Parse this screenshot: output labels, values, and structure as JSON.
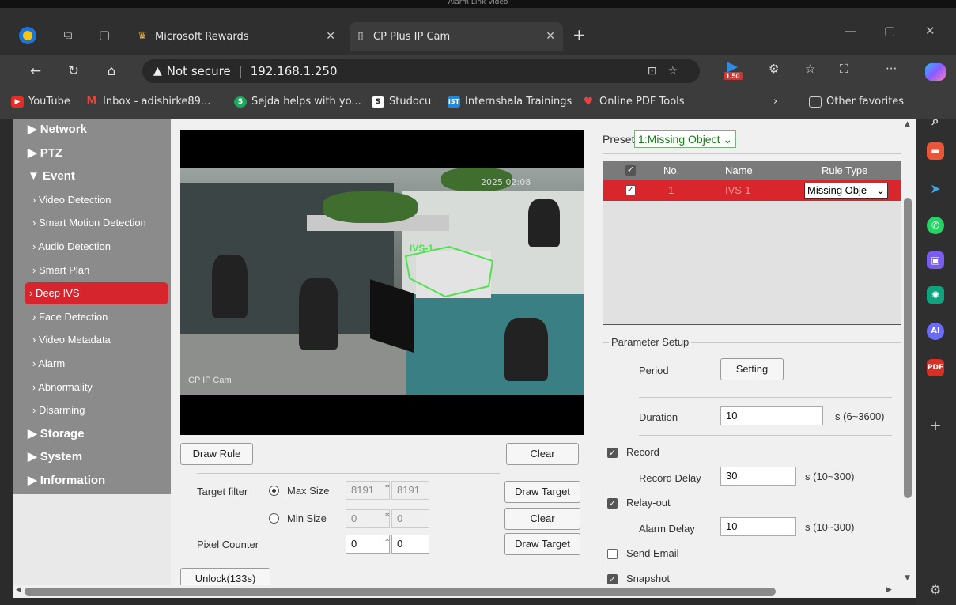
{
  "top_title": "Alarm Link Video",
  "browser": {
    "tabs": [
      {
        "label": "Microsoft Rewards"
      },
      {
        "label": "CP Plus IP Cam"
      }
    ],
    "security_label": "Not secure",
    "url": "192.168.1.250",
    "reader_badge": "1.50",
    "favorites": [
      {
        "label": "YouTube"
      },
      {
        "label": "Inbox - adishirke89..."
      },
      {
        "label": "Sejda helps with yo..."
      },
      {
        "label": "Studocu"
      },
      {
        "label": "Internshala Trainings"
      },
      {
        "label": "Online PDF Tools"
      }
    ],
    "other_favorites": "Other favorites"
  },
  "nav": {
    "items": [
      {
        "label": "Network",
        "level": "top",
        "arrow": "▶"
      },
      {
        "label": "PTZ",
        "level": "top",
        "arrow": "▶"
      },
      {
        "label": "Event",
        "level": "top",
        "arrow": "▼"
      },
      {
        "label": "Video Detection",
        "level": "sub"
      },
      {
        "label": "Smart Motion Detection",
        "level": "sub"
      },
      {
        "label": "Audio Detection",
        "level": "sub"
      },
      {
        "label": "Smart Plan",
        "level": "sub"
      },
      {
        "label": "Deep IVS",
        "level": "sub",
        "active": true
      },
      {
        "label": "Face Detection",
        "level": "sub"
      },
      {
        "label": "Video Metadata",
        "level": "sub"
      },
      {
        "label": "Alarm",
        "level": "sub"
      },
      {
        "label": "Abnormality",
        "level": "sub"
      },
      {
        "label": "Disarming",
        "level": "sub"
      },
      {
        "label": "Storage",
        "level": "top",
        "arrow": "▶"
      },
      {
        "label": "System",
        "level": "top",
        "arrow": "▶"
      },
      {
        "label": "Information",
        "level": "top",
        "arrow": "▶"
      }
    ]
  },
  "video": {
    "camera_label": "CP IP Cam",
    "rule_label": "IVS-1",
    "timestamp": "2025 02:08"
  },
  "controls": {
    "draw_rule": "Draw Rule",
    "clear": "Clear",
    "target_filter_label": "Target filter",
    "max_size_label": "Max Size",
    "min_size_label": "Min Size",
    "max_w": "8191",
    "max_h": "8191",
    "min_w": "0",
    "min_h": "0",
    "draw_target": "Draw Target",
    "clear2": "Clear",
    "pixel_counter_label": "Pixel Counter",
    "pixel_w": "0",
    "pixel_h": "0",
    "draw_target2": "Draw Target",
    "unlock": "Unlock(133s)",
    "times": "*"
  },
  "preset": {
    "label": "Preset",
    "value": "1:Missing Object"
  },
  "rules_table": {
    "headers": [
      "No.",
      "Name",
      "Rule Type"
    ],
    "rows": [
      {
        "no": "1",
        "name": "IVS-1",
        "type": "Missing Obje"
      }
    ]
  },
  "params": {
    "legend": "Parameter Setup",
    "period_label": "Period",
    "setting_button": "Setting",
    "duration_label": "Duration",
    "duration_value": "10",
    "duration_range": "s (6~3600)",
    "record_label": "Record",
    "record_delay_label": "Record Delay",
    "record_delay_value": "30",
    "record_delay_range": "s (10~300)",
    "relay_label": "Relay-out",
    "alarm_delay_label": "Alarm Delay",
    "alarm_delay_value": "10",
    "alarm_delay_range": "s (10~300)",
    "send_email_label": "Send Email",
    "snapshot_label": "Snapshot"
  }
}
